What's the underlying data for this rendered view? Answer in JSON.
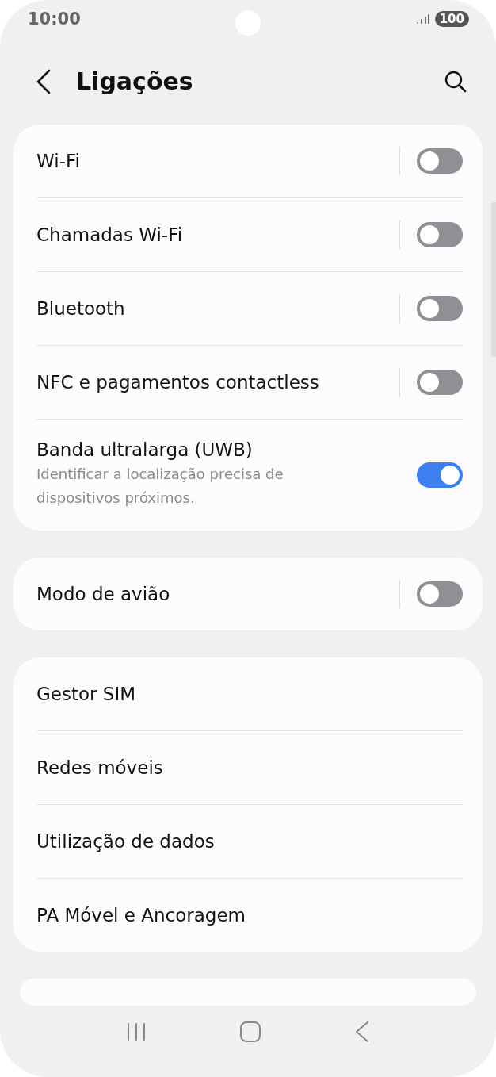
{
  "status_bar": {
    "time": "10:00",
    "battery": "100"
  },
  "header": {
    "title": "Ligações"
  },
  "sections": [
    {
      "items": [
        {
          "kind": "toggle",
          "label": "Wi-Fi",
          "on": false
        },
        {
          "kind": "toggle",
          "label": "Chamadas Wi-Fi",
          "on": false
        },
        {
          "kind": "toggle",
          "label": "Bluetooth",
          "on": false
        },
        {
          "kind": "toggle",
          "label": "NFC e pagamentos contactless",
          "on": false
        },
        {
          "kind": "toggle",
          "label": "Banda ultralarga (UWB)",
          "description": "Identificar a localização precisa de dispositivos próximos.",
          "on": true
        }
      ]
    },
    {
      "items": [
        {
          "kind": "toggle",
          "label": "Modo de avião",
          "on": false
        }
      ]
    },
    {
      "items": [
        {
          "kind": "link",
          "label": "Gestor SIM"
        },
        {
          "kind": "link",
          "label": "Redes móveis"
        },
        {
          "kind": "link",
          "label": "Utilização de dados"
        },
        {
          "kind": "link",
          "label": "PA Móvel e Ancoragem"
        }
      ]
    }
  ]
}
